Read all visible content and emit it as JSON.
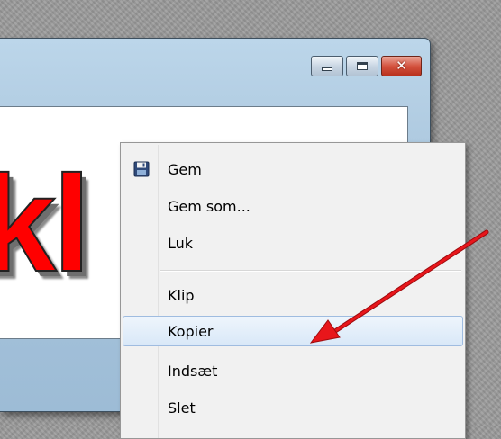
{
  "window": {
    "controls": {
      "minimize_icon": "minimize-icon",
      "maximize_icon": "maximize-icon",
      "close_icon": "close-icon",
      "close_symbol": "✕"
    },
    "content_text": "kl",
    "content_text_color": "#ff0000"
  },
  "context_menu": {
    "items": [
      {
        "label": "Gem",
        "icon": "floppy-disk-icon"
      },
      {
        "label": "Gem som..."
      },
      {
        "label": "Luk"
      },
      {
        "label": "Klip"
      },
      {
        "label": "Kopier",
        "highlighted": true
      },
      {
        "label": "Indsæt"
      },
      {
        "label": "Slet"
      }
    ],
    "highlight_color": "#d9e8f8"
  },
  "annotation": {
    "arrow_color": "#e8161b",
    "points_to": "Kopier"
  }
}
